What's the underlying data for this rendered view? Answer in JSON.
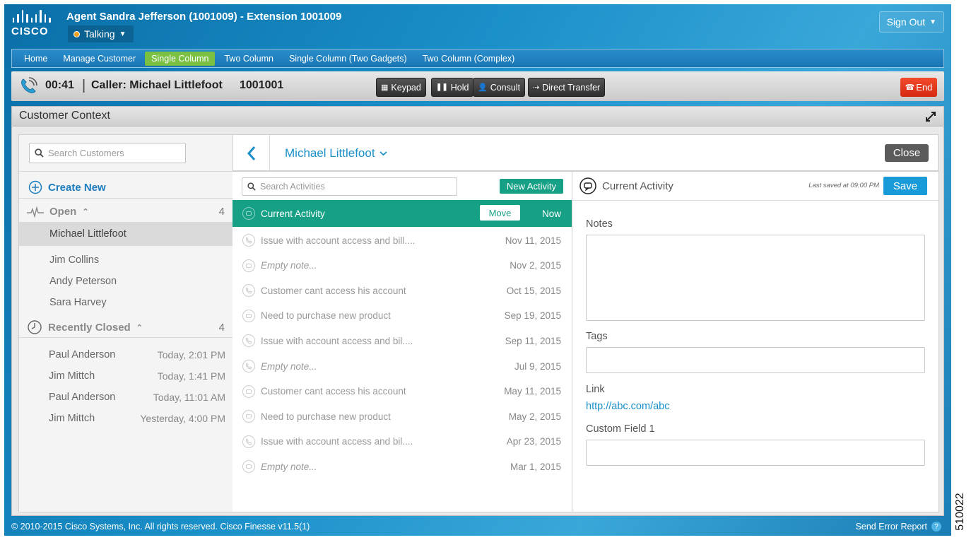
{
  "header": {
    "agent_title": "Agent Sandra Jefferson (1001009) - Extension 1001009",
    "logo_text": "CISCO",
    "state": "Talking",
    "sign_out": "Sign Out"
  },
  "nav": {
    "tabs": [
      {
        "label": "Home",
        "active": false
      },
      {
        "label": "Manage Customer",
        "active": false
      },
      {
        "label": "Single Column",
        "active": true
      },
      {
        "label": "Two Column",
        "active": false
      },
      {
        "label": "Single Column (Two Gadgets)",
        "active": false
      },
      {
        "label": "Two Column (Complex)",
        "active": false
      }
    ]
  },
  "call": {
    "timer": "00:41",
    "separator": "|",
    "caller_label": "Caller: Michael Littlefoot",
    "caller_number": "1001001",
    "buttons": {
      "keypad": "Keypad",
      "hold": "Hold",
      "consult": "Consult",
      "direct_transfer": "Direct Transfer"
    },
    "end": "End"
  },
  "gadget": {
    "title": "Customer Context"
  },
  "customers": {
    "search_placeholder": "Search Customers",
    "create_new": "Create New",
    "open": {
      "label": "Open",
      "count": "4",
      "items": [
        "Michael Littlefoot",
        "Jim Collins",
        "Andy Peterson",
        "Sara Harvey"
      ],
      "selected": "Michael Littlefoot"
    },
    "recently_closed": {
      "label": "Recently Closed",
      "count": "4",
      "items": [
        {
          "name": "Paul Anderson",
          "time": "Today, 2:01 PM"
        },
        {
          "name": "Jim Mittch",
          "time": "Today, 1:41 PM"
        },
        {
          "name": "Paul Anderson",
          "time": "Today, 11:01 AM"
        },
        {
          "name": "Jim Mittch",
          "time": "Yesterday, 4:00 PM"
        }
      ]
    }
  },
  "customer_header": {
    "name": "Michael Littlefoot",
    "close": "Close"
  },
  "activities": {
    "search_placeholder": "Search Activities",
    "new_activity": "New Activity",
    "current": {
      "label": "Current Activity",
      "move": "Move",
      "time": "Now"
    },
    "items": [
      {
        "label": "Issue with account access and bill....",
        "date": "Nov 11, 2015",
        "type": "phone",
        "empty": false
      },
      {
        "label": "Empty note...",
        "date": "Nov 2, 2015",
        "type": "chat",
        "empty": true
      },
      {
        "label": "Customer cant access his account",
        "date": "Oct 15, 2015",
        "type": "phone",
        "empty": false
      },
      {
        "label": "Need to purchase new product",
        "date": "Sep 19, 2015",
        "type": "chat",
        "empty": false
      },
      {
        "label": "Issue with account access and bil....",
        "date": "Sep 11, 2015",
        "type": "phone",
        "empty": false
      },
      {
        "label": "Empty note...",
        "date": "Jul 9, 2015",
        "type": "phone",
        "empty": true
      },
      {
        "label": "Customer cant access his account",
        "date": "May 11, 2015",
        "type": "chat",
        "empty": false
      },
      {
        "label": "Need to purchase new product",
        "date": "May 2, 2015",
        "type": "chat",
        "empty": false
      },
      {
        "label": "Issue with account access and bil....",
        "date": "Apr 23, 2015",
        "type": "phone",
        "empty": false
      },
      {
        "label": "Empty note...",
        "date": "Mar 1, 2015",
        "type": "chat",
        "empty": true
      }
    ]
  },
  "detail": {
    "title": "Current Activity",
    "last_saved": "Last saved at 09:00 PM",
    "save": "Save",
    "notes_label": "Notes",
    "tags_label": "Tags",
    "link_label": "Link",
    "link_value": "http://abc.com/abc",
    "custom_field_label": "Custom Field 1"
  },
  "footer": {
    "copyright": "© 2010-2015 Cisco Systems, Inc. All rights reserved. Cisco Finesse v11.5(1)",
    "send_error": "Send Error Report",
    "help": "?"
  },
  "figure_id": "510022",
  "colors": {
    "accent_green": "#16a085",
    "link_blue": "#1a8fc8",
    "end_red": "#e0341a",
    "active_tab": "#7ac143"
  }
}
